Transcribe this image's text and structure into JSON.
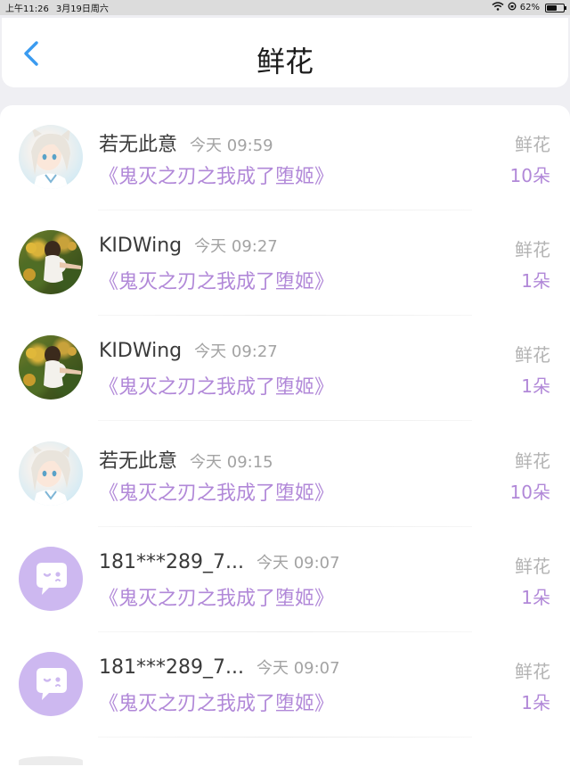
{
  "status_bar": {
    "time": "上午11:26",
    "date": "3月19日周六",
    "battery": "62%",
    "battery_level": 0.62,
    "icons": [
      "wifi-icon",
      "orientation-lock-icon",
      "battery-icon"
    ]
  },
  "header": {
    "title": "鲜花",
    "back_icon": "chevron-left-icon",
    "accent_color": "#3a9bf0"
  },
  "colors": {
    "accent_purple": "#b188d8",
    "muted_gray": "#a3a3a3",
    "name_text": "#3a3a3a"
  },
  "items": [
    {
      "user": "若无此意",
      "time": "今天 09:59",
      "book": "《鬼灭之刃之我成了堕姬》",
      "gift": "鲜花",
      "amount": "10朵",
      "avatar": "anime-girl-avatar"
    },
    {
      "user": "KIDWing",
      "time": "今天 09:27",
      "book": "《鬼灭之刃之我成了堕姬》",
      "gift": "鲜花",
      "amount": "1朵",
      "avatar": "garden-photo-avatar"
    },
    {
      "user": "KIDWing",
      "time": "今天 09:27",
      "book": "《鬼灭之刃之我成了堕姬》",
      "gift": "鲜花",
      "amount": "1朵",
      "avatar": "garden-photo-avatar"
    },
    {
      "user": "若无此意",
      "time": "今天 09:15",
      "book": "《鬼灭之刃之我成了堕姬》",
      "gift": "鲜花",
      "amount": "10朵",
      "avatar": "anime-girl-avatar"
    },
    {
      "user": "181***289_7...",
      "time": "今天 09:07",
      "book": "《鬼灭之刃之我成了堕姬》",
      "gift": "鲜花",
      "amount": "1朵",
      "avatar": "default-chat-avatar"
    },
    {
      "user": "181***289_7...",
      "time": "今天 09:07",
      "book": "《鬼灭之刃之我成了堕姬》",
      "gift": "鲜花",
      "amount": "1朵",
      "avatar": "default-chat-avatar"
    }
  ]
}
